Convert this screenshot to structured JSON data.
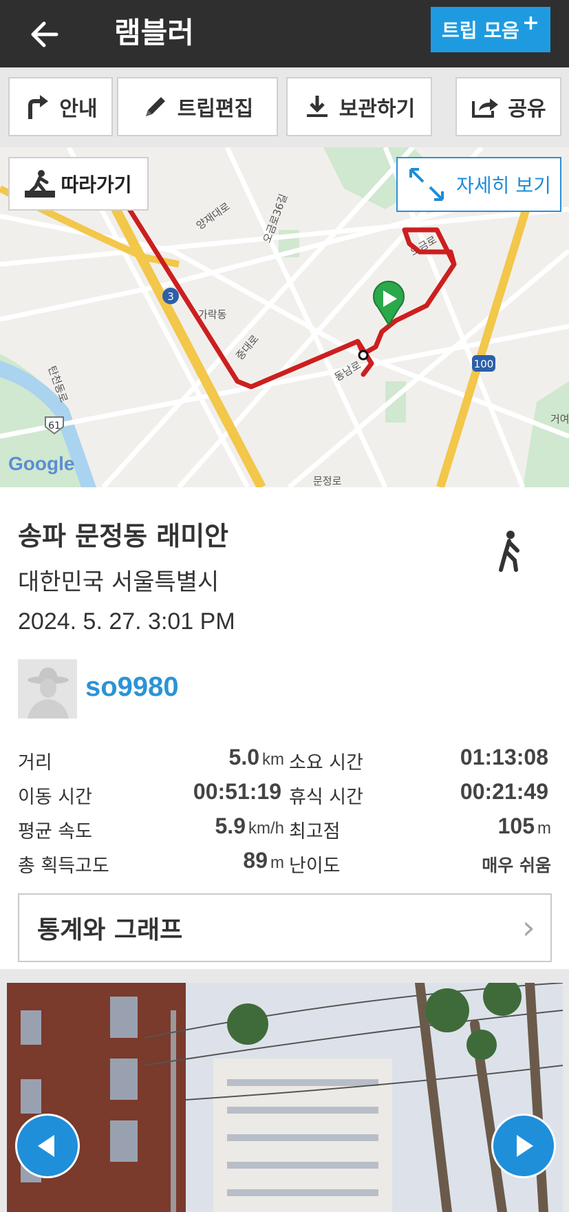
{
  "header": {
    "title": "램블러",
    "trip_collection_label": "트립 모음",
    "trip_collection_plus": "+"
  },
  "actions": [
    {
      "label": "안내",
      "icon": "turn-right-arrow-icon"
    },
    {
      "label": "트립편집",
      "icon": "pencil-icon"
    },
    {
      "label": "보관하기",
      "icon": "download-icon"
    },
    {
      "label": "공유",
      "icon": "share-icon"
    }
  ],
  "map": {
    "follow_label": "따라가기",
    "detail_label": "자세히 보기",
    "attribution": "Google",
    "labels": [
      "양재대로",
      "오금로36길",
      "가락동",
      "중대로",
      "동남로",
      "오금로",
      "탄천동로",
      "3",
      "61",
      "100",
      "거여",
      "문정로"
    ],
    "route_color": "#cc1f1f"
  },
  "trip": {
    "name": "송파 문정동 래미안",
    "region": "대한민국 서울특별시",
    "date": "2024. 5. 27. 3:01 PM",
    "activity_icon": "walking-icon",
    "username": "so9980"
  },
  "stats": {
    "distance_label": "거리",
    "distance_value": "5.0",
    "distance_unit": "km",
    "duration_label": "소요 시간",
    "duration_value": "01:13:08",
    "moving_label": "이동 시간",
    "moving_value": "00:51:19",
    "rest_label": "휴식 시간",
    "rest_value": "00:21:49",
    "avg_speed_label": "평균 속도",
    "avg_speed_value": "5.9",
    "avg_speed_unit": "km/h",
    "max_alt_label": "최고점",
    "max_alt_value": "105",
    "max_alt_unit": "m",
    "gain_label": "총 획득고도",
    "gain_value": "89",
    "gain_unit": "m",
    "difficulty_label": "난이도",
    "difficulty_value": "매우 쉬움"
  },
  "graph_button": {
    "label": "통계와 그래프",
    "chevron": "›"
  },
  "colors": {
    "accent": "#1e9be0",
    "header_bg": "#2f2f2f",
    "username": "#2b93d6"
  }
}
